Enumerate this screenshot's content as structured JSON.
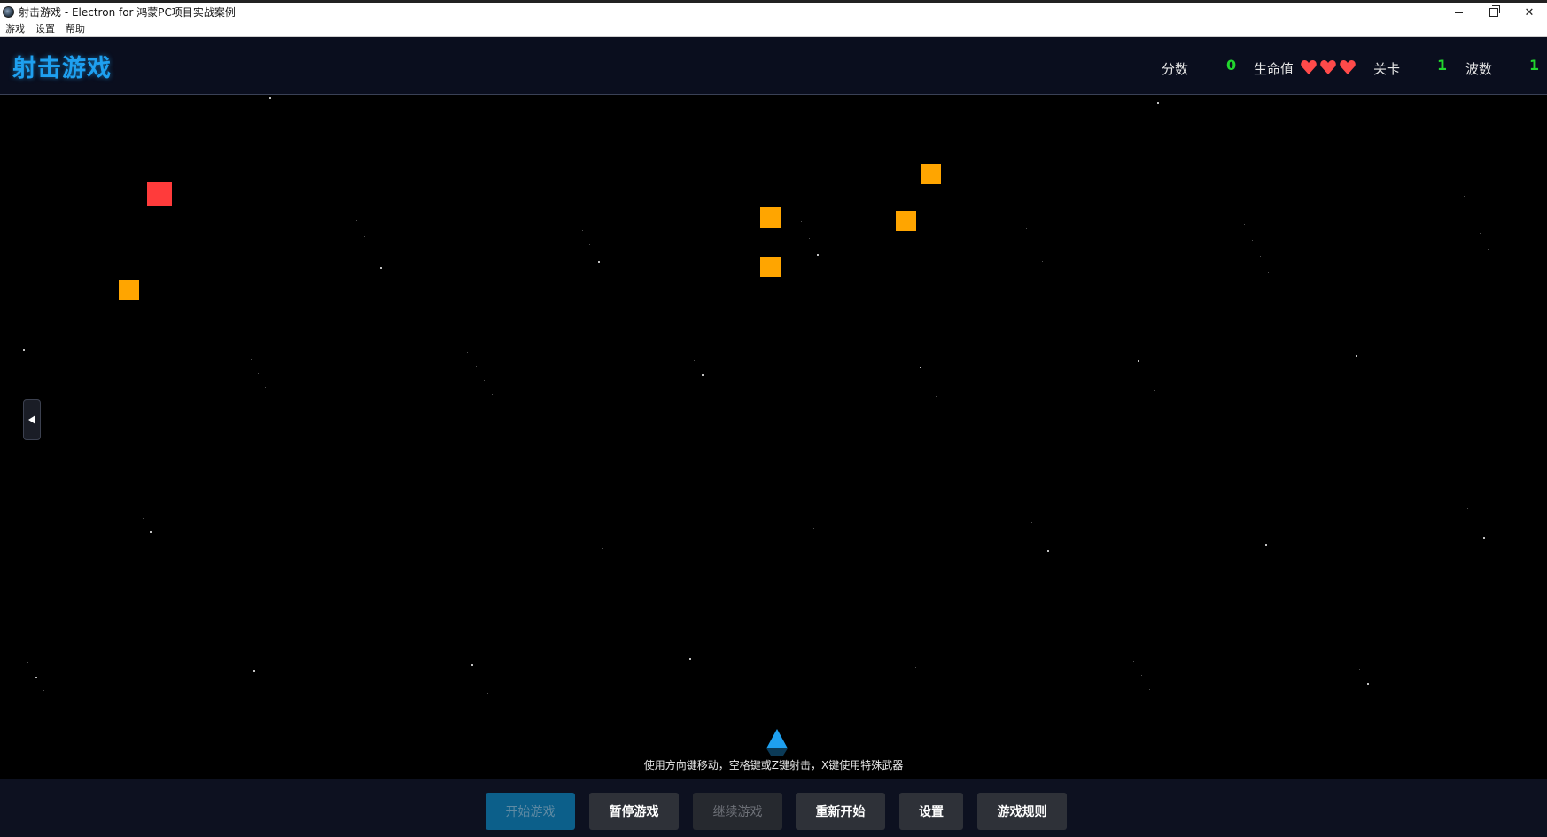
{
  "window": {
    "title": "射击游戏 - Electron for 鸿蒙PC项目实战案例",
    "minimize_label": "",
    "close_label": "✕"
  },
  "menu": {
    "items": [
      "游戏",
      "设置",
      "帮助"
    ]
  },
  "header": {
    "title": "射击游戏",
    "score_label": "分数",
    "score_value": "0",
    "lives_label": "生命值",
    "lives_count": 3,
    "level_label": "关卡",
    "level_value": "1",
    "wave_label": "波数",
    "wave_value": "1"
  },
  "game": {
    "controls_hint": "使用方向键移动，空格键或Z键射击，X键使用特殊武器",
    "player_color": "#1ea0f0",
    "enemy_colors": {
      "orange": "#ffa500",
      "red": "#ff3b3b"
    }
  },
  "buttons": {
    "start": "开始游戏",
    "pause": "暂停游戏",
    "resume": "继续游戏",
    "restart": "重新开始",
    "settings": "设置",
    "rules": "游戏规则"
  },
  "colors": {
    "accent": "#1ea0f0",
    "stat_value": "#22d62e",
    "heart": "#ff4a4a",
    "header_bg": "#0a0e1e"
  }
}
